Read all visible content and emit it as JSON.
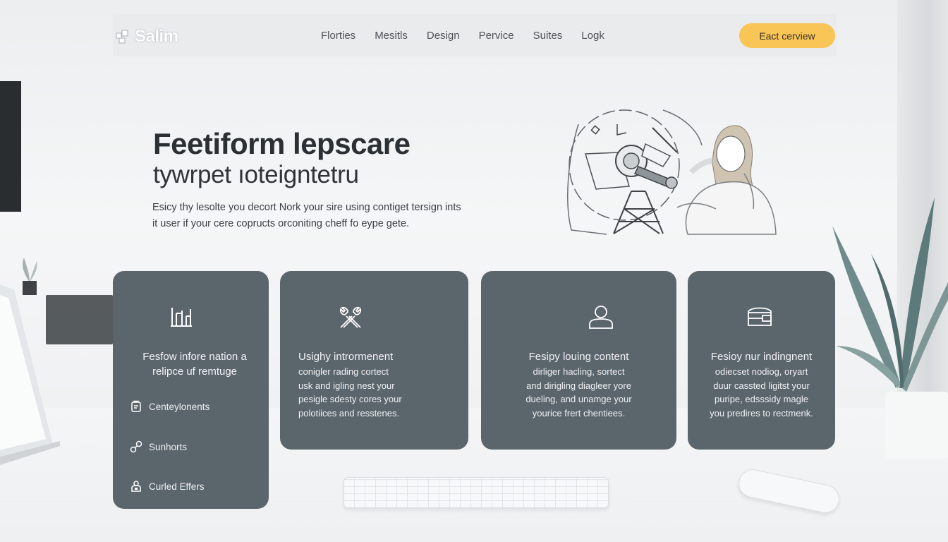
{
  "header": {
    "logo_text": "Salim",
    "nav": [
      "Florties",
      "Mesitls",
      "Design",
      "Pervice",
      "Suites",
      "Logk"
    ],
    "cta_label": "Eact cerview"
  },
  "hero": {
    "title": "Feetiform lepscare",
    "subtitle": "tywrpet ıoteigntetru",
    "desc_line1": "Esicy thy lesolte you decort Nork your sire using contiget tersign ints",
    "desc_line2": "it user if your cere copructs orconiting cheff fo eype gete."
  },
  "cards": [
    {
      "icon": "chart-bars-icon",
      "title_line1": "Fesfow infore nation a",
      "title_line2": "relipce uf remtuge",
      "features": [
        {
          "icon": "clipboard-icon",
          "label": "Centeylonents"
        },
        {
          "icon": "link-icon",
          "label": "Sunhorts"
        },
        {
          "icon": "person-lock-icon",
          "label": "Curled Effers"
        }
      ]
    },
    {
      "icon": "tools-icon",
      "title": "Usighy intrormenent",
      "body": [
        "conigler rading cortect",
        "usk and igling nest your",
        "pesigle sdesty cores your",
        "polotiices and resstenes."
      ]
    },
    {
      "icon": "user-icon",
      "title": "Fesipy louing content",
      "body": [
        "dirliger hacling, sortect",
        "and dirigling diagleer yore",
        "dueling, and unamge your",
        "yourice frert chentiees."
      ]
    },
    {
      "icon": "wallet-icon",
      "title": "Fesioy nur indingnent",
      "body": [
        "odiecset nodiog, oryart",
        "duur cassted ligitst your",
        "puripe, edsssidy magle",
        "you predires to rectmenk."
      ]
    }
  ],
  "colors": {
    "card_bg": "#5b656c",
    "accent": "#f8c556",
    "page_bg": "#f1f2f3"
  }
}
